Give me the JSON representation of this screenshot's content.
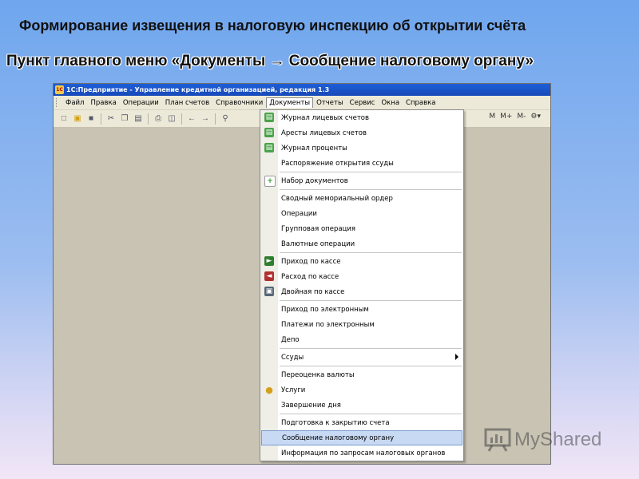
{
  "slide": {
    "title": "Формирование извещения в налоговую инспекцию об открытии счёта",
    "subtitle": "Пункт главного меню «Документы → Сообщение налоговому органу»"
  },
  "window": {
    "title": "1С:Предприятие - Управление кредитной организацией, редакция 1.3",
    "app_icon_text": "1С"
  },
  "menubar": {
    "items": [
      "Файл",
      "Правка",
      "Операции",
      "План счетов",
      "Справочники",
      "Документы",
      "Отчеты",
      "Сервис",
      "Окна",
      "Справка"
    ],
    "active": "Документы"
  },
  "toolbar": {
    "right_labels": [
      "M",
      "M+",
      "M-"
    ]
  },
  "documents_menu": {
    "items": [
      {
        "label": "Журнал лицевых счетов",
        "icon": "journal-icon",
        "color": "#4aa34a"
      },
      {
        "label": "Аресты лицевых счетов",
        "icon": "journal-icon",
        "color": "#4aa34a"
      },
      {
        "label": "Журнал проценты",
        "icon": "journal-icon",
        "color": "#4aa34a"
      },
      {
        "label": "Распоряжение открытия ссуды"
      },
      {
        "label": "Набор документов",
        "icon": "add-document-icon",
        "color": "#3a9a3a"
      },
      {
        "label": "Сводный мемориальный ордер"
      },
      {
        "label": "Операции"
      },
      {
        "label": "Групповая операция"
      },
      {
        "label": "Валютные операции"
      },
      {
        "label": "Приход по кассе",
        "icon": "cash-in-icon",
        "color": "#2f7d2f"
      },
      {
        "label": "Расход по кассе",
        "icon": "cash-out-icon",
        "color": "#b03030"
      },
      {
        "label": "Двойная по кассе",
        "icon": "cash-double-icon",
        "color": "#556677"
      },
      {
        "label": "Приход по электронным"
      },
      {
        "label": "Платежи по электронным"
      },
      {
        "label": "Депо"
      },
      {
        "label": "Ссуды",
        "submenu": true
      },
      {
        "label": "Переоценка валюты"
      },
      {
        "label": "Услуги",
        "icon": "services-icon",
        "color": "#d4a017"
      },
      {
        "label": "Завершение дня"
      },
      {
        "label": "Подготовка к закрытию счета"
      },
      {
        "label": "Сообщение налоговому органу",
        "highlighted": true
      },
      {
        "label": "Информация по запросам налоговых органов"
      }
    ]
  },
  "watermark": {
    "text": "MyShared"
  }
}
